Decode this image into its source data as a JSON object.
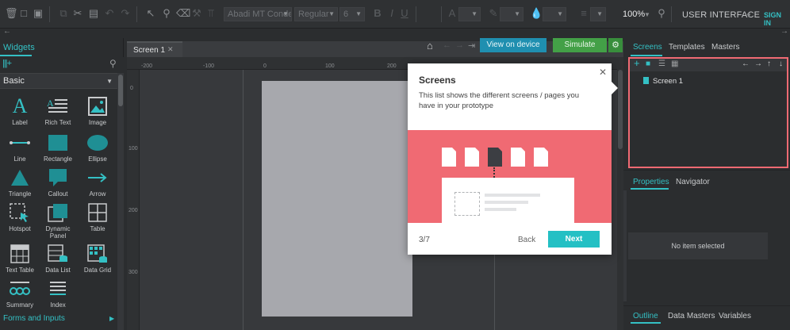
{
  "toolbar": {
    "font_name": "Abadi MT Condensed",
    "font_style": "Regular",
    "font_size": "6",
    "zoom": "100%",
    "mode": "USER INTERFACE",
    "signin": "SIGN IN",
    "icons": [
      "trash-icon",
      "folder-icon",
      "save-icon",
      "copy-icon",
      "cut-icon",
      "paste-icon",
      "undo-icon",
      "redo-icon",
      "pointer-icon",
      "zoom-icon",
      "eraser-icon",
      "format-painter-icon",
      "bold-icon",
      "italic-icon",
      "underline-icon",
      "text-color-icon",
      "pen-icon",
      "fill-icon",
      "align-icon",
      "search-icon"
    ]
  },
  "left_panel": {
    "tab": "Widgets",
    "library": "Basic",
    "widgets": [
      {
        "label": "Label",
        "icon": "label-icon"
      },
      {
        "label": "Rich Text",
        "icon": "rich-text-icon"
      },
      {
        "label": "Image",
        "icon": "image-icon"
      },
      {
        "label": "Line",
        "icon": "line-icon"
      },
      {
        "label": "Rectangle",
        "icon": "rectangle-icon"
      },
      {
        "label": "Ellipse",
        "icon": "ellipse-icon"
      },
      {
        "label": "Triangle",
        "icon": "triangle-icon"
      },
      {
        "label": "Callout",
        "icon": "callout-icon"
      },
      {
        "label": "Arrow",
        "icon": "arrow-icon"
      },
      {
        "label": "Hotspot",
        "icon": "hotspot-icon"
      },
      {
        "label": "Dynamic Panel",
        "icon": "dynamic-panel-icon"
      },
      {
        "label": "Table",
        "icon": "table-icon"
      },
      {
        "label": "Text Table",
        "icon": "text-table-icon"
      },
      {
        "label": "Data List",
        "icon": "data-list-icon"
      },
      {
        "label": "Data Grid",
        "icon": "data-grid-icon"
      },
      {
        "label": "Summary",
        "icon": "summary-icon"
      },
      {
        "label": "Index",
        "icon": "index-icon"
      }
    ],
    "section": "Forms and Inputs"
  },
  "canvas": {
    "tab": "Screen 1",
    "ruler_top": [
      "-200",
      "-100",
      "0",
      "100",
      "200"
    ],
    "ruler_left": [
      "0",
      "100",
      "200",
      "300"
    ],
    "view_on_device": "View on device",
    "simulate": "Simulate"
  },
  "tour": {
    "title": "Screens",
    "description": "This list shows the different screens / pages you have in your prototype",
    "step": "3/7",
    "back": "Back",
    "next": "Next"
  },
  "right_panel": {
    "tabs": [
      "Screens",
      "Templates",
      "Masters"
    ],
    "screens": [
      "Screen 1"
    ],
    "prop_tabs": [
      "Properties",
      "Navigator"
    ],
    "no_item": "No item selected",
    "bottom_tabs": [
      "Outline",
      "Data Masters",
      "Variables"
    ]
  },
  "colors": {
    "accent": "#34c0c4",
    "device_button": "#1f8fb0",
    "simulate_button": "#43a047",
    "tour_illustration": "#f06a73",
    "highlight_border": "#f06a73"
  }
}
